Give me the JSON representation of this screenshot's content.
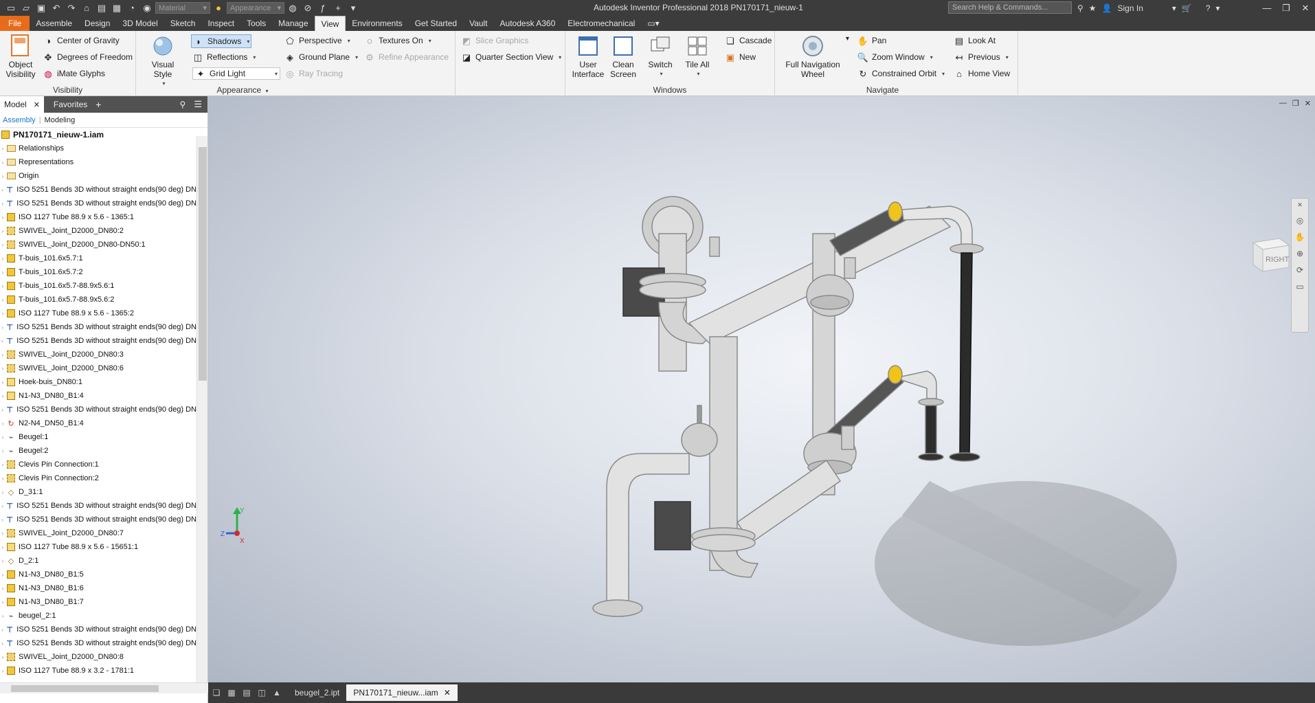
{
  "titlebar": {
    "material_placeholder": "Material",
    "appearance_placeholder": "Appearance",
    "title": "Autodesk Inventor Professional 2018    PN170171_nieuw-1",
    "search_placeholder": "Search Help & Commands...",
    "sign_in": "Sign In"
  },
  "tabs": [
    "File",
    "Assemble",
    "Design",
    "3D Model",
    "Sketch",
    "Inspect",
    "Tools",
    "Manage",
    "View",
    "Environments",
    "Get Started",
    "Vault",
    "Autodesk A360",
    "Electromechanical"
  ],
  "active_tab": "View",
  "ribbon": {
    "visibility": {
      "title": "Visibility",
      "object_visibility": "Object Visibility",
      "center_of_gravity": "Center of Gravity",
      "degrees_of_freedom": "Degrees of Freedom",
      "imate_glyphs": "iMate Glyphs"
    },
    "appearance": {
      "title": "Appearance",
      "visual_style": "Visual Style",
      "shadows": "Shadows",
      "reflections": "Reflections",
      "grid_light": "Grid Light",
      "perspective": "Perspective",
      "ground_plane": "Ground Plane",
      "ray_tracing": "Ray Tracing",
      "textures_on": "Textures On",
      "refine_appearance": "Refine Appearance",
      "slice_graphics": "Slice Graphics",
      "quarter_section_view": "Quarter Section View"
    },
    "windows": {
      "title": "Windows",
      "user_interface": "User Interface",
      "clean_screen": "Clean Screen",
      "switch": "Switch",
      "tile_all": "Tile All",
      "cascade": "Cascade",
      "new": "New"
    },
    "navigate": {
      "title": "Navigate",
      "full_navigation_wheel": "Full Navigation Wheel",
      "pan": "Pan",
      "zoom_window": "Zoom Window",
      "constrained_orbit": "Constrained Orbit",
      "look_at": "Look At",
      "previous": "Previous",
      "home_view": "Home View"
    }
  },
  "browser": {
    "tab_model": "Model",
    "tab_favorites": "Favorites",
    "sub_assembly": "Assembly",
    "sub_modeling": "Modeling",
    "root": "PN170171_nieuw-1.iam",
    "items": [
      {
        "label": "Relationships",
        "icon": "folder"
      },
      {
        "label": "Representations",
        "icon": "folder"
      },
      {
        "label": "Origin",
        "icon": "folder"
      },
      {
        "label": "ISO 5251 Bends 3D without straight ends(90 deg) DN",
        "icon": "bend"
      },
      {
        "label": "ISO 5251 Bends 3D without straight ends(90 deg) DN",
        "icon": "bend"
      },
      {
        "label": "ISO 1127 Tube 88.9 x 5.6 - 1365:1",
        "icon": "part"
      },
      {
        "label": "SWIVEL_Joint_D2000_DN80:2",
        "icon": "assembly"
      },
      {
        "label": "SWIVEL_Joint_D2000_DN80-DN50:1",
        "icon": "assembly"
      },
      {
        "label": "T-buis_101.6x5.7:1",
        "icon": "part"
      },
      {
        "label": "T-buis_101.6x5.7:2",
        "icon": "part"
      },
      {
        "label": "T-buis_101.6x5.7-88.9x5.6:1",
        "icon": "part"
      },
      {
        "label": "T-buis_101.6x5.7-88.9x5.6:2",
        "icon": "part"
      },
      {
        "label": "ISO 1127 Tube 88.9 x 5.6 - 1365:2",
        "icon": "part"
      },
      {
        "label": "ISO 5251 Bends 3D without straight ends(90 deg) DN",
        "icon": "bend"
      },
      {
        "label": "ISO 5251 Bends 3D without straight ends(90 deg) DN",
        "icon": "bend"
      },
      {
        "label": "SWIVEL_Joint_D2000_DN80:3",
        "icon": "assembly"
      },
      {
        "label": "SWIVEL_Joint_D2000_DN80:6",
        "icon": "assembly"
      },
      {
        "label": "Hoek-buis_DN80:1",
        "icon": "weld"
      },
      {
        "label": "N1-N3_DN80_B1:4",
        "icon": "weld"
      },
      {
        "label": "ISO 5251 Bends 3D without straight ends(90 deg) DN",
        "icon": "bend"
      },
      {
        "label": "N2-N4_DN50_B1:4",
        "icon": "adaptive"
      },
      {
        "label": "Beugel:1",
        "icon": "clamp"
      },
      {
        "label": "Beugel:2",
        "icon": "clamp"
      },
      {
        "label": "Clevis Pin Connection:1",
        "icon": "assembly"
      },
      {
        "label": "Clevis Pin Connection:2",
        "icon": "assembly"
      },
      {
        "label": "D_31:1",
        "icon": "ipart"
      },
      {
        "label": "ISO 5251 Bends 3D without straight ends(90 deg) DN",
        "icon": "bend"
      },
      {
        "label": "ISO 5251 Bends 3D without straight ends(90 deg) DN",
        "icon": "bend"
      },
      {
        "label": "SWIVEL_Joint_D2000_DN80:7",
        "icon": "assembly"
      },
      {
        "label": "ISO 1127 Tube 88.9 x 5.6 - 15651:1",
        "icon": "weld"
      },
      {
        "label": "D_2:1",
        "icon": "ipart"
      },
      {
        "label": "N1-N3_DN80_B1:5",
        "icon": "part"
      },
      {
        "label": "N1-N3_DN80_B1:6",
        "icon": "part"
      },
      {
        "label": "N1-N3_DN80_B1:7",
        "icon": "part"
      },
      {
        "label": "beugel_2:1",
        "icon": "clamp"
      },
      {
        "label": "ISO 5251 Bends 3D without straight ends(90 deg) DN",
        "icon": "bend"
      },
      {
        "label": "ISO 5251 Bends 3D without straight ends(90 deg) DN",
        "icon": "bend"
      },
      {
        "label": "SWIVEL_Joint_D2000_DN80:8",
        "icon": "assembly"
      },
      {
        "label": "ISO 1127 Tube 88.9 x 3.2 - 1781:1",
        "icon": "part"
      }
    ]
  },
  "viewcube_label": "RIGHT",
  "triad": {
    "x": "X",
    "y": "Y",
    "z": "Z"
  },
  "doc_tabs": [
    {
      "label": "beugel_2.ipt",
      "active": false
    },
    {
      "label": "PN170171_nieuw...iam",
      "active": true
    }
  ],
  "colors": {
    "file_tab": "#e86b1a",
    "titlebar": "#3c3c3c",
    "pipe": "#d9d9d9",
    "flange": "#cfcfcf",
    "hose": "#2b2b2b",
    "accent": "#f0c419"
  }
}
